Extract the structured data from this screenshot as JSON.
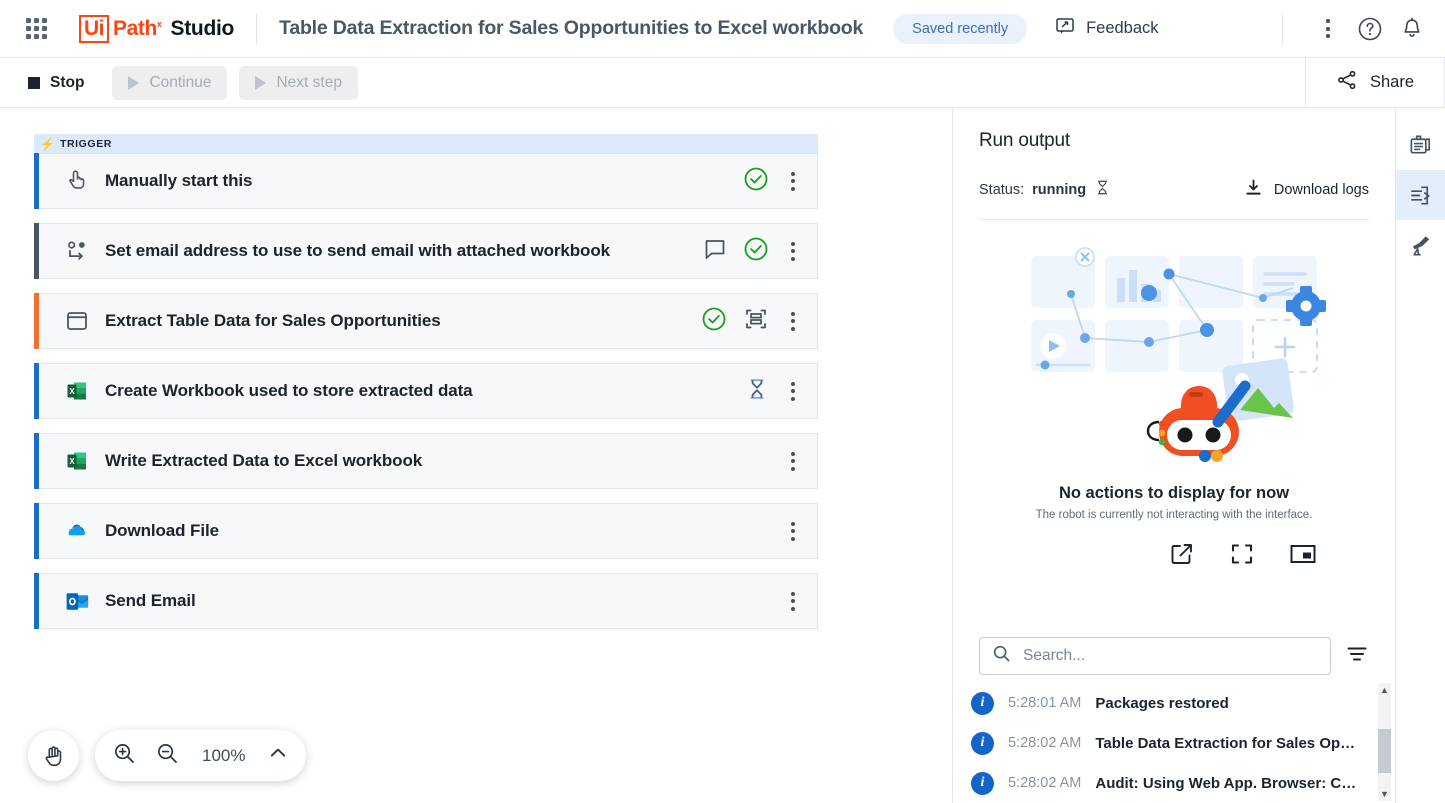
{
  "topbar": {
    "apps_icon": "apps-grid-icon",
    "brand_ui": "Ui",
    "brand_path": "Path",
    "brand_studio": "Studio",
    "document_title": "Table Data Extraction for Sales Opportunities to Excel workbook",
    "saved_status": "Saved recently",
    "feedback_label": "Feedback",
    "more_icon": "more-vertical-icon",
    "help_icon": "help-circle-icon",
    "notifications_icon": "bell-icon"
  },
  "toolbar": {
    "stop_label": "Stop",
    "continue_label": "Continue",
    "next_step_label": "Next step",
    "share_label": "Share"
  },
  "canvas": {
    "trigger_label": "TRIGGER",
    "cards": [
      {
        "label": "Manually start this",
        "icon": "hand-click-icon",
        "accent": "#1a6ccd",
        "actions": [
          "check-circle-icon",
          "kebab-menu-icon"
        ]
      },
      {
        "label": "Set email address to use to send email with attached workbook",
        "icon": "set-variable-icon",
        "accent": "#4b5662",
        "actions": [
          "comment-icon",
          "check-circle-icon",
          "kebab-menu-icon"
        ]
      },
      {
        "label": "Extract Table Data for Sales Opportunities",
        "icon": "browser-window-icon",
        "accent": "#f2712c",
        "actions": [
          "check-circle-icon",
          "table-extract-icon",
          "kebab-menu-icon"
        ]
      },
      {
        "label": "Create Workbook used to store extracted data",
        "icon": "excel-icon",
        "accent": "#1a6ccd",
        "actions": [
          "hourglass-icon",
          "kebab-menu-icon"
        ]
      },
      {
        "label": "Write Extracted Data to Excel workbook",
        "icon": "excel-icon",
        "accent": "#1a6ccd",
        "actions": [
          "kebab-menu-icon"
        ]
      },
      {
        "label": "Download File",
        "icon": "onedrive-icon",
        "accent": "#1a6ccd",
        "actions": [
          "kebab-menu-icon"
        ]
      },
      {
        "label": "Send Email",
        "icon": "outlook-icon",
        "accent": "#1a6ccd",
        "actions": [
          "kebab-menu-icon"
        ]
      }
    ],
    "pan_tool_icon": "hand-pan-icon",
    "zoom_in_icon": "zoom-in-icon",
    "zoom_out_icon": "zoom-out-icon",
    "zoom_level": "100%",
    "zoom_chevron_icon": "chevron-up-icon"
  },
  "run_output": {
    "title": "Run output",
    "status_label": "Status:",
    "status_value": "running",
    "status_icon": "hourglass-icon",
    "download_logs_label": "Download logs",
    "download_icon": "download-icon",
    "empty_title": "No actions to display for now",
    "empty_subtitle": "The robot is currently not interacting with the interface.",
    "view_buttons": [
      "open-external-icon",
      "fullscreen-icon",
      "picture-in-picture-icon"
    ],
    "search_placeholder": "Search...",
    "search_value": "",
    "search_icon": "search-icon",
    "filter_icon": "filter-icon",
    "logs": [
      {
        "level": "info",
        "time": "5:28:01 AM",
        "message": "Packages restored"
      },
      {
        "level": "info",
        "time": "5:28:02 AM",
        "message": "Table Data Extraction for Sales Opportu..."
      },
      {
        "level": "info",
        "time": "5:28:02 AM",
        "message": "Audit: Using Web App. Browser: Chrome ..."
      }
    ]
  },
  "rail": {
    "items": [
      {
        "icon": "job-details-icon",
        "active": false
      },
      {
        "icon": "run-output-icon",
        "active": true
      },
      {
        "icon": "telescope-icon",
        "active": false
      }
    ]
  },
  "colors": {
    "brand_orange": "#fa4616",
    "accent_blue": "#1a6ccd",
    "accent_orange": "#f2712c",
    "success_green": "#17a01a",
    "info_blue": "#1565c9"
  }
}
